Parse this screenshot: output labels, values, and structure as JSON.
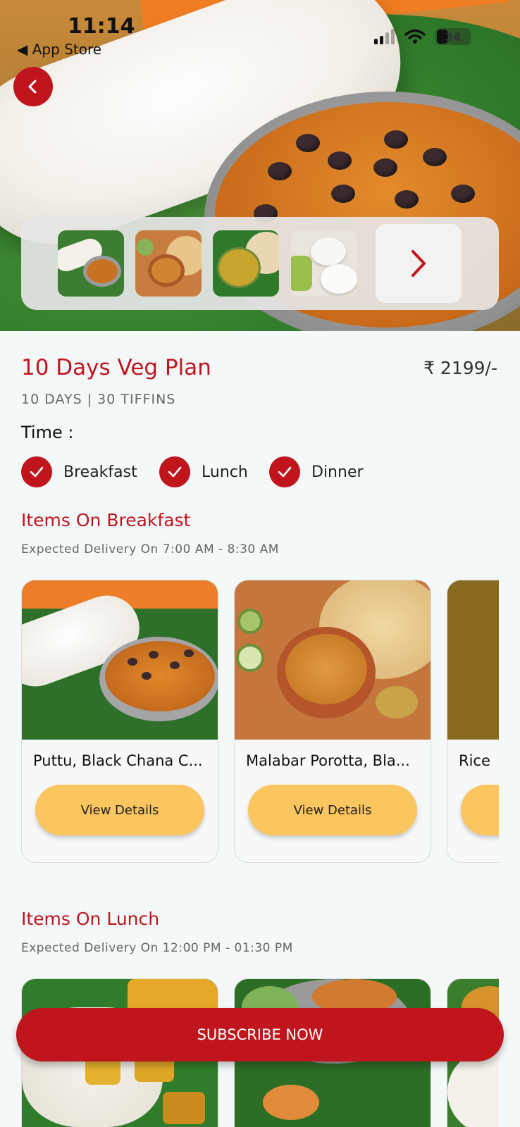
{
  "status_bar": {
    "time": "11:14",
    "back_app": "◀ App Store",
    "battery": "34"
  },
  "plan": {
    "title": "10 Days Veg Plan",
    "price": "₹ 2199/-",
    "subtitle": "10 DAYS | 30 TIFFINS",
    "time_label": "Time :",
    "time_options": [
      {
        "label": "Breakfast",
        "checked": true
      },
      {
        "label": "Lunch",
        "checked": true
      },
      {
        "label": "Dinner",
        "checked": true
      }
    ]
  },
  "breakfast": {
    "title": "Items On Breakfast",
    "delivery": "Expected Delivery On 7:00 AM - 8:30 AM",
    "items": [
      {
        "name": "Puttu, Black Chana C...",
        "button": "View Details"
      },
      {
        "name": "Malabar Porotta, Bla...",
        "button": "View Details"
      },
      {
        "name": "Rice",
        "button": ""
      }
    ]
  },
  "lunch": {
    "title": "Items On Lunch",
    "delivery": "Expected Delivery On 12:00 PM - 01:30 PM"
  },
  "cta": {
    "subscribe": "SUBSCRIBE NOW"
  },
  "colors": {
    "brand_red": "#c0151d",
    "button_yellow": "#fbc560",
    "background": "#f4f8f9"
  },
  "icons": [
    "back-arrow-icon",
    "chevron-right-icon",
    "check-icon",
    "signal-icon",
    "wifi-icon",
    "battery-icon"
  ]
}
